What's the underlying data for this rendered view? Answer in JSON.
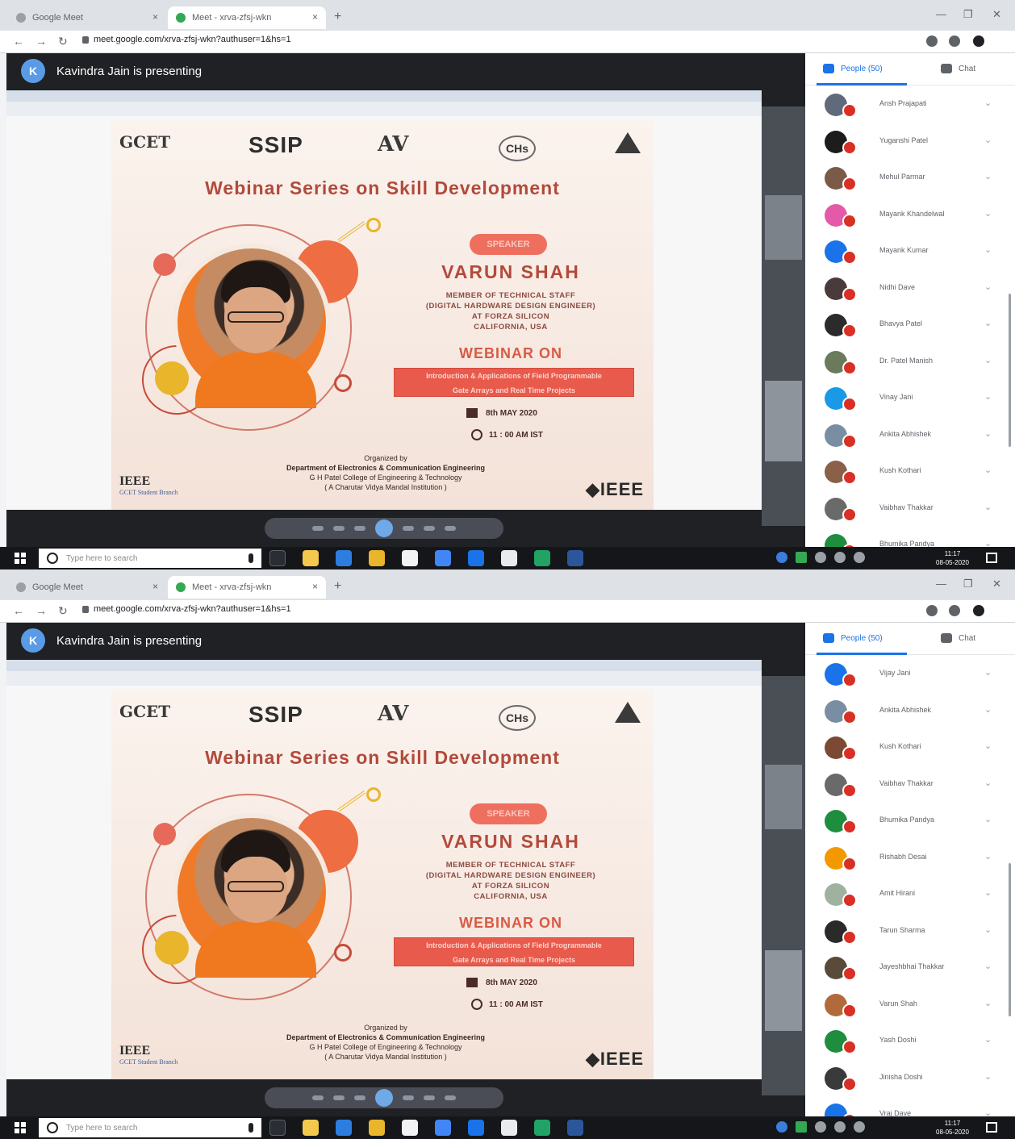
{
  "browser": {
    "tabs": [
      {
        "label": "Google Meet"
      },
      {
        "label": "Meet - xrva-zfsj-wkn"
      }
    ],
    "new_tab": "+",
    "url": "meet.google.com/xrva-zfsj-wkn?authuser=1&hs=1"
  },
  "meet": {
    "presenting_text": "Kavindra Jain is presenting",
    "presenter_initial": "K",
    "people_tab": "People (50)",
    "chat_tab": "Chat"
  },
  "poster": {
    "logos": [
      "GCET",
      "SSIP",
      "AV",
      "CHs",
      ""
    ],
    "title": "Webinar Series on Skill Development",
    "speaker_pill": "SPEAKER",
    "speaker_name": "VARUN SHAH",
    "role_lines": [
      "MEMBER OF TECHNICAL STAFF",
      "(DIGITAL HARDWARE DESIGN ENGINEER)",
      "AT FORZA SILICON",
      "CALIFORNIA, USA"
    ],
    "webinar_on": "WEBINAR ON",
    "topic_lines": [
      "Introduction & Applications of Field Programmable",
      "Gate Arrays and Real Time Projects"
    ],
    "date": "8th MAY 2020",
    "time": "11 : 00 AM IST",
    "organized_by": "Organized by",
    "org_lines": [
      "Department of Electronics & Communication Engineering",
      "G H Patel College of Engineering & Technology",
      "( A Charutar Vidya Mandal Institution )"
    ],
    "ieee_sb": "IEEE",
    "ieee_sb_sub": "GCET Student Branch",
    "ieee_logo": "◆IEEE"
  },
  "participants_top": [
    {
      "name": "Ansh Prajapati",
      "color": "#5f6b7a"
    },
    {
      "name": "Yuganshi Patel",
      "color": "#1c1c1c"
    },
    {
      "name": "Mehul Parmar",
      "color": "#7c5a48"
    },
    {
      "name": "Mayank Khandelwal",
      "color": "#e45aa8"
    },
    {
      "name": "Mayank Kumar",
      "color": "#1a73e8"
    },
    {
      "name": "Nidhi Dave",
      "color": "#4a3b3b"
    },
    {
      "name": "Bhavya Patel",
      "color": "#2b2b2b"
    },
    {
      "name": "Dr. Patel Manish",
      "color": "#6a7a5a"
    },
    {
      "name": "Vinay Jani",
      "color": "#1a9ae6"
    },
    {
      "name": "Ankita Abhishek",
      "color": "#7a8ea3"
    },
    {
      "name": "Kush Kothari",
      "color": "#8a6048"
    },
    {
      "name": "Vaibhav Thakkar",
      "color": "#6a6a6a"
    },
    {
      "name": "Bhumika Pandya",
      "color": "#1e8e3e"
    }
  ],
  "participants_bottom": [
    {
      "name": "Vijay Jani",
      "color": "#1a73e8"
    },
    {
      "name": "Ankita Abhishek",
      "color": "#7a8ea3"
    },
    {
      "name": "Kush Kothari",
      "color": "#7c4a34"
    },
    {
      "name": "Vaibhav Thakkar",
      "color": "#6a6a6a"
    },
    {
      "name": "Bhumika Pandya",
      "color": "#1e8e3e"
    },
    {
      "name": "Rishabh Desai",
      "color": "#f29900"
    },
    {
      "name": "Amit Hirani",
      "color": "#9fb2a0"
    },
    {
      "name": "Tarun Sharma",
      "color": "#2a2a2a"
    },
    {
      "name": "Jayeshbhai Thakkar",
      "color": "#5a4a3a"
    },
    {
      "name": "Varun Shah",
      "color": "#b26a3a"
    },
    {
      "name": "Yash Doshi",
      "color": "#1e8e3e"
    },
    {
      "name": "Jinisha Doshi",
      "color": "#3a3a3a"
    },
    {
      "name": "Vraj Dave",
      "color": "#1a73e8"
    }
  ],
  "taskbar": {
    "search_placeholder": "Type here to search",
    "clock_time": "11:17",
    "clock_date": "08-05-2020"
  }
}
